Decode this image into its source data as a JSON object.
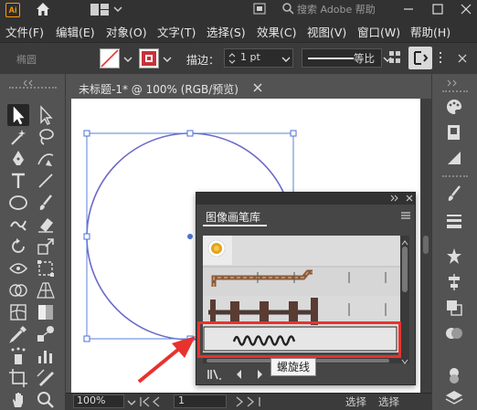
{
  "app": {
    "logo": "Ai",
    "search_placeholder": "搜索 Adobe 帮助"
  },
  "menu": [
    "文件(F)",
    "编辑(E)",
    "对象(O)",
    "文字(T)",
    "选择(S)",
    "效果(C)",
    "视图(V)",
    "窗口(W)",
    "帮助(H)"
  ],
  "control_bar": {
    "selection_type": "椭圆",
    "stroke_label": "描边：",
    "stroke_value": "1 pt",
    "profile_label": "等比"
  },
  "document": {
    "tab_label": "未标题-1* @ 100% (RGB/预览)"
  },
  "status": {
    "zoom": "100%",
    "page": "1",
    "select_1": "选择",
    "select_2": "选择"
  },
  "brush_panel": {
    "title": "图像画笔库"
  },
  "tooltip": "螺旋线",
  "colors": {
    "accent": "#e8322d",
    "shape_stroke": "#6b6bc8",
    "artboard": "#ffffff",
    "ui_dark": "#323232"
  },
  "icons": {
    "toolbar_left": [
      "selection-tool-icon",
      "direct-selection-tool-icon",
      "magic-wand-icon",
      "lasso-icon",
      "pen-tool-icon",
      "curvature-tool-icon",
      "type-tool-icon",
      "line-tool-icon",
      "ellipse-tool-icon",
      "paintbrush-icon",
      "blob-brush-icon",
      "eraser-icon",
      "rotate-tool-icon",
      "scale-tool-icon",
      "width-tool-icon",
      "free-transform-icon",
      "shape-builder-icon",
      "perspective-grid-icon",
      "mesh-tool-icon",
      "gradient-tool-icon",
      "eyedropper-icon",
      "blend-tool-icon",
      "symbol-sprayer-icon",
      "column-graph-icon",
      "artboard-tool-icon",
      "slice-tool-icon",
      "hand-tool-icon",
      "zoom-tool-icon"
    ]
  }
}
